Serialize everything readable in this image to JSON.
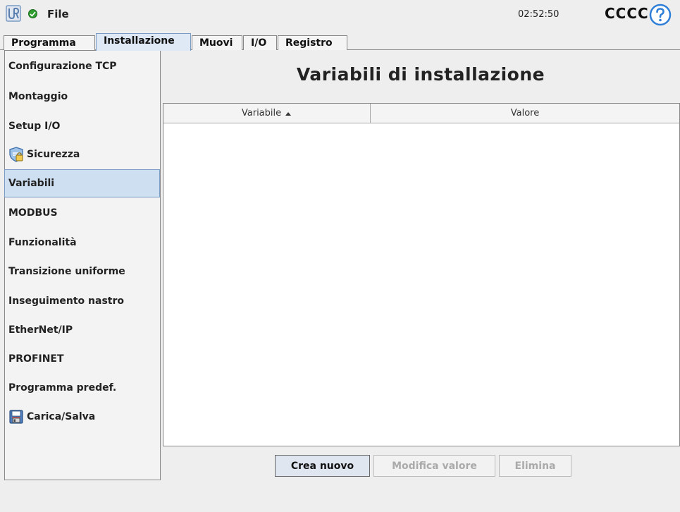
{
  "header": {
    "file_label": "File",
    "clock": "02:52:50",
    "robot_name": "CCCC",
    "status_color": "#2e9c2e"
  },
  "tabs": [
    {
      "label": "Programma",
      "active": false
    },
    {
      "label": "Installazione",
      "active": true
    },
    {
      "label": "Muovi",
      "active": false
    },
    {
      "label": "I/O",
      "active": false
    },
    {
      "label": "Registro",
      "active": false
    }
  ],
  "sidebar": {
    "items": [
      {
        "label": "Configurazione TCP"
      },
      {
        "label": "Montaggio"
      },
      {
        "label": "Setup I/O"
      },
      {
        "label": "Sicurezza",
        "icon": "shield-icon"
      },
      {
        "label": "Variabili",
        "selected": true
      },
      {
        "label": "MODBUS"
      },
      {
        "label": "Funzionalità"
      },
      {
        "label": "Transizione uniforme"
      },
      {
        "label": "Inseguimento nastro"
      },
      {
        "label": "EtherNet/IP"
      },
      {
        "label": "PROFINET"
      },
      {
        "label": "Programma predef."
      },
      {
        "label": "Carica/Salva",
        "icon": "floppy-disk-icon"
      }
    ]
  },
  "main": {
    "title": "Variabili di installazione",
    "table": {
      "columns": [
        {
          "label": "Variabile",
          "sort": "ascending"
        },
        {
          "label": "Valore"
        }
      ],
      "rows": []
    },
    "buttons": {
      "create": "Crea nuovo",
      "edit": "Modifica valore",
      "delete": "Elimina"
    }
  },
  "colors": {
    "accent": "#7a9cc4",
    "selected_bg": "#cfdff2",
    "help_blue": "#2f7fd8"
  }
}
